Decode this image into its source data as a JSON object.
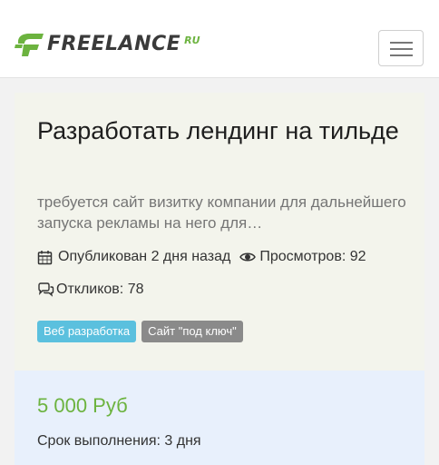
{
  "header": {
    "logo_text": "FREELANCE",
    "logo_suffix": "RU",
    "menu_icon": "hamburger-menu-icon"
  },
  "project": {
    "title": "Разработать лендинг на тильде",
    "description": "требуется сайт визитку компании для дальнейшего запуска рекламы на него для…",
    "published_label": "Опубликован 2 дня назад",
    "views_label": "Просмотров: 92",
    "responses_label": "Откликов: 78",
    "tags": [
      "Веб разработка",
      "Сайт \"под ключ\""
    ]
  },
  "offer": {
    "price": "5 000 Руб",
    "deadline": "Срок выполнения: 3 дня"
  },
  "colors": {
    "brand_green": "#6cb33f",
    "tag_blue": "#5bc0de",
    "tag_gray": "#8a8a8a",
    "card_bg": "#f3f4ec",
    "price_bg": "#e8f0fc"
  },
  "icons": {
    "published": "calendar-icon",
    "views": "eye-icon",
    "responses": "comments-icon"
  }
}
